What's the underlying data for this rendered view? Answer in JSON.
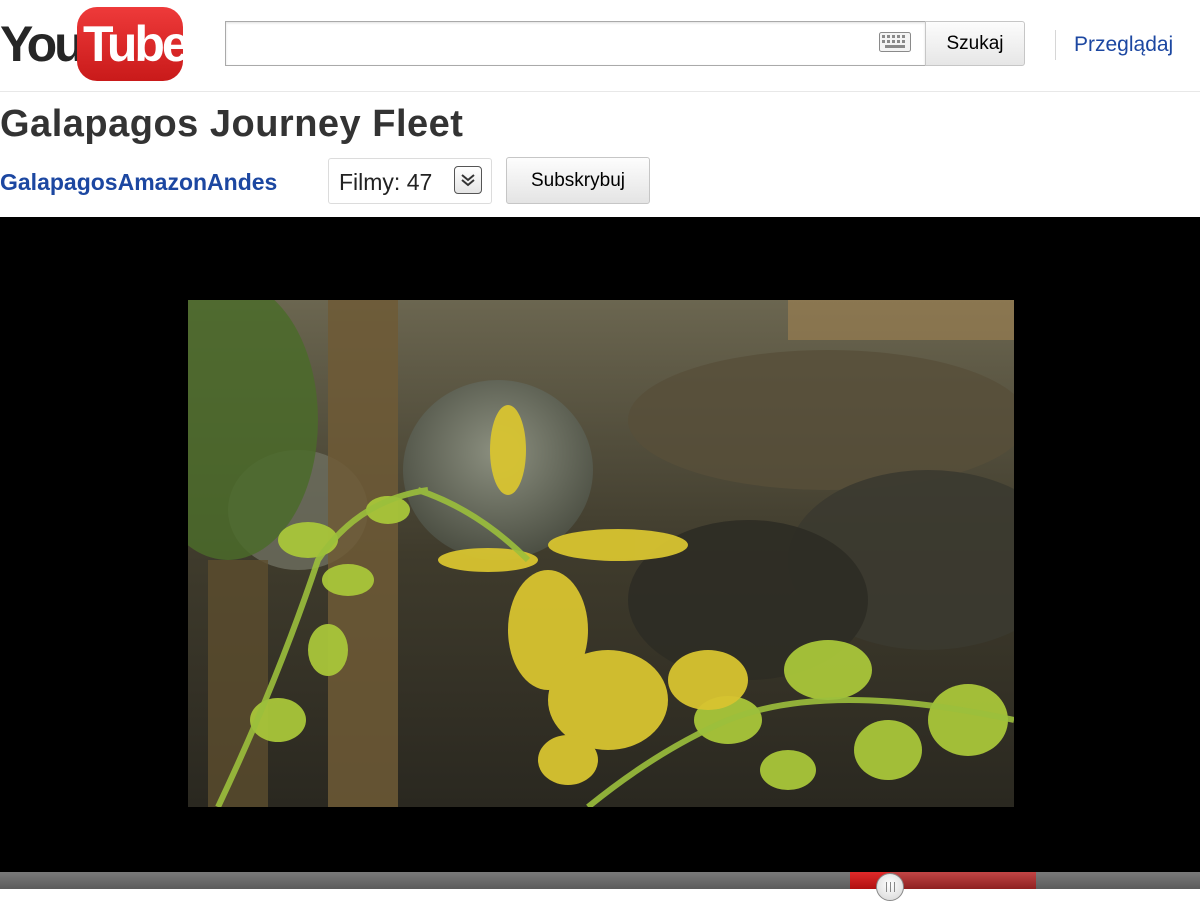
{
  "header": {
    "logo": {
      "you": "You",
      "tube": "Tube",
      "brand_color": "#e62117"
    },
    "search": {
      "value": "",
      "placeholder": "",
      "button_label": "Szukaj"
    },
    "browse_label": "Przeglądaj",
    "icons": {
      "keyboard": "keyboard-icon"
    }
  },
  "video": {
    "title": "Galapagos Journey Fleet",
    "channel": "GalapagosAmazonAndes",
    "videos_count_label": "Filmy: 47",
    "subscribe_label": "Subskrybuj"
  },
  "player": {
    "progress_played_fraction": 0.74,
    "progress_loaded_fraction": 0.86,
    "colors": {
      "played": "#cc181e",
      "track": "#666666",
      "background": "#000000"
    }
  }
}
